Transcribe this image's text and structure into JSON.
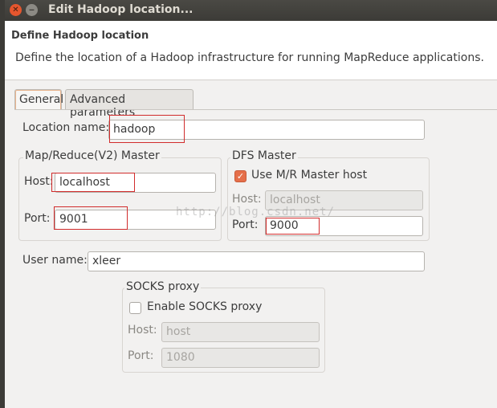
{
  "window": {
    "title": "Edit Hadoop location...",
    "close_glyph": "✕",
    "minimize_glyph": "‒"
  },
  "header": {
    "title": "Define Hadoop location",
    "description": "Define the location of a Hadoop infrastructure for running MapReduce applications."
  },
  "tabs": [
    {
      "label": "General",
      "active": true
    },
    {
      "label": "Advanced parameters",
      "active": false
    }
  ],
  "general": {
    "location_name_label": "Location name:",
    "location_name_value": "hadoop",
    "mapreduce": {
      "group_label": "Map/Reduce(V2) Master",
      "host_label": "Host:",
      "host_value": "localhost",
      "port_label": "Port:",
      "port_value": "9001"
    },
    "dfs": {
      "group_label": "DFS Master",
      "use_mr_host_label": "Use M/R Master host",
      "use_mr_host_checked": true,
      "check_glyph": "✓",
      "host_label": "Host:",
      "host_value": "localhost",
      "port_label": "Port:",
      "port_value": "9000"
    },
    "user_name_label": "User name:",
    "user_name_value": "xleer",
    "socks": {
      "group_label": "SOCKS proxy",
      "enable_label": "Enable SOCKS proxy",
      "enable_checked": false,
      "host_label": "Host:",
      "host_value": "host",
      "port_label": "Port:",
      "port_value": "1080"
    }
  },
  "watermark": "http://blog.csdn.net/",
  "colors": {
    "accent_orange": "#e56f4a",
    "annotation_red": "#d12c2c",
    "titlebar": "#3c3b37"
  }
}
